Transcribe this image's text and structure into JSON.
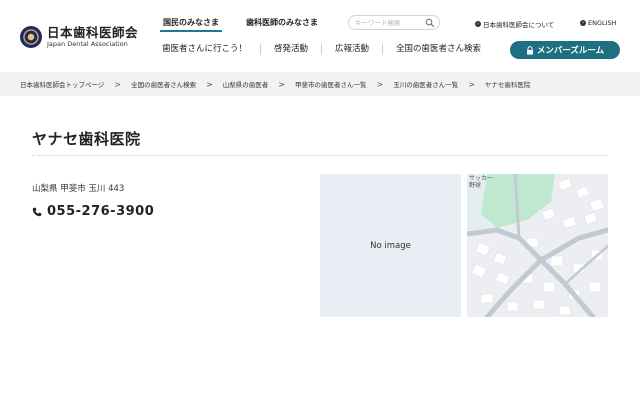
{
  "header": {
    "logo": {
      "jp": "日本歯科医師会",
      "en": "Japan Dental Association"
    },
    "tabs": [
      {
        "label": "国民のみなさま",
        "active": true
      },
      {
        "label": "歯科医師のみなさま",
        "active": false
      }
    ],
    "search": {
      "placeholder": "キーワード検索",
      "icon": "search-icon"
    },
    "top_links": [
      {
        "label": "日本歯科医師会について",
        "icon": "arrow-circle-icon"
      },
      {
        "label": "ENGLISH",
        "icon": "arrow-circle-icon"
      }
    ],
    "nav": [
      "歯医者さんに行こう！",
      "啓発活動",
      "広報活動",
      "全国の歯医者さん検索"
    ],
    "member_button": {
      "label": "メンバーズルーム",
      "icon": "lock-icon"
    },
    "accent_color": "#1f6f83"
  },
  "breadcrumb": [
    "日本歯科医師会トップページ",
    "全国の歯医者さん検索",
    "山梨県の歯医者",
    "甲斐市の歯医者さん一覧",
    "玉川の歯医者さん一覧",
    "ヤナセ歯科医院"
  ],
  "clinic": {
    "name": "ヤナセ歯科医院",
    "address": "山梨県 甲斐市 玉川 443",
    "phone": "055-276-3900",
    "image_placeholder": "No image",
    "map_label_line1": "サッカー",
    "map_label_line2": "野球"
  }
}
